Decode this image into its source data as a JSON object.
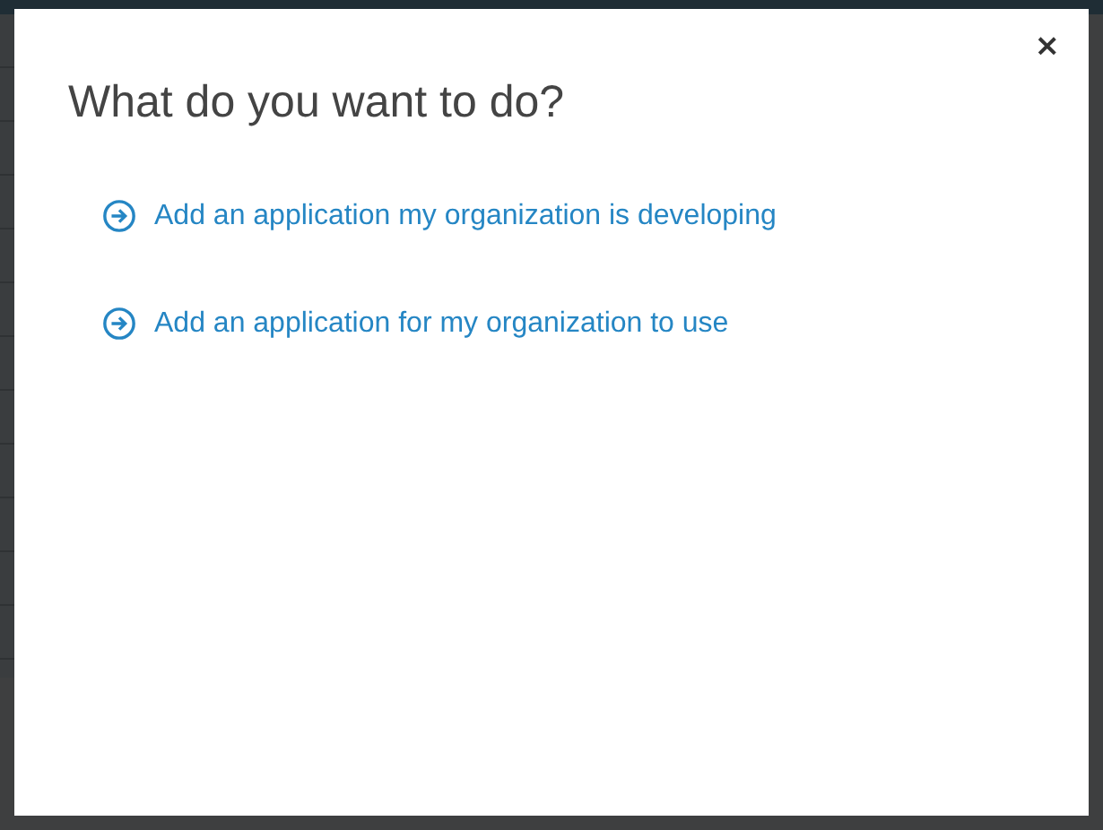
{
  "dialog": {
    "title": "What do you want to do?",
    "close": "×",
    "options": [
      {
        "label": "Add an application my organization is developing"
      },
      {
        "label": "Add an application for my organization to use"
      }
    ]
  }
}
